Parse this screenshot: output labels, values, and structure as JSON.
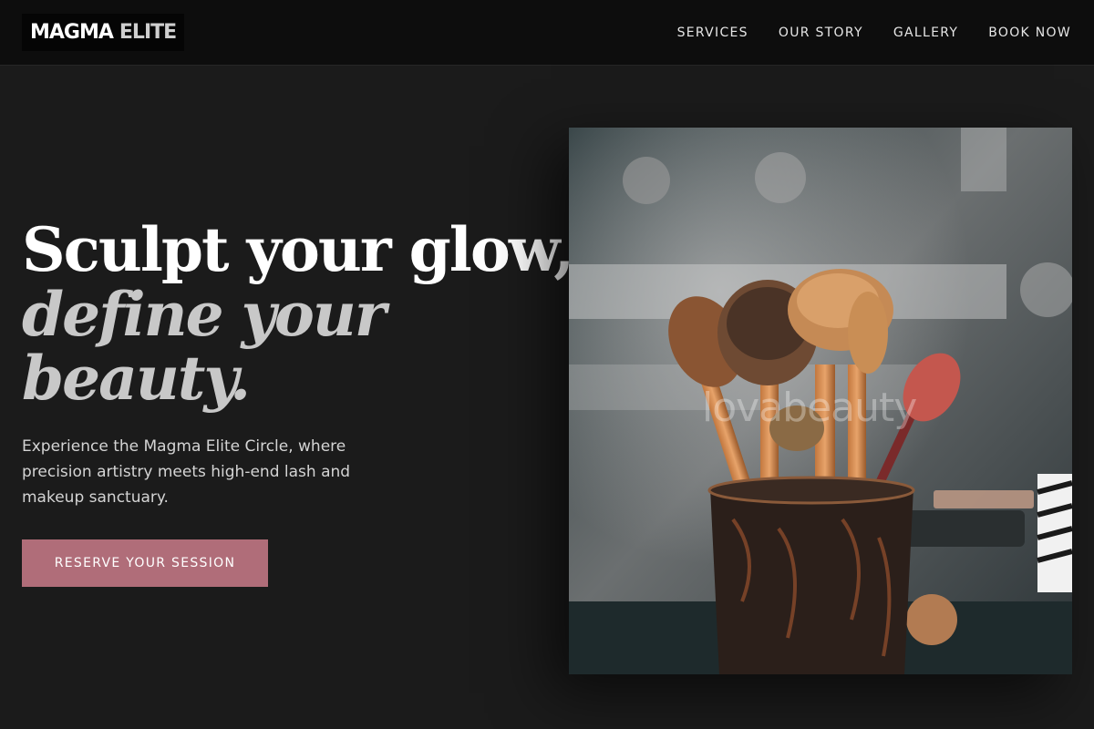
{
  "brand": {
    "name_primary": "MAGMA",
    "name_secondary": "ELITE"
  },
  "nav": {
    "items": [
      "SERVICES",
      "OUR STORY",
      "GALLERY",
      "BOOK NOW"
    ]
  },
  "hero": {
    "headline_line1": "Sculpt your glow,",
    "headline_line2": "define your beauty.",
    "description": "Experience the Magma Elite Circle, where precision artistry meets high-end lash and makeup sanctuary.",
    "cta_label": "RESERVE YOUR SESSION",
    "image_watermark": "lovabeauty"
  },
  "colors": {
    "accent": "#b06d79",
    "background": "#1b1b1b",
    "nav_background": "#0d0d0d"
  }
}
